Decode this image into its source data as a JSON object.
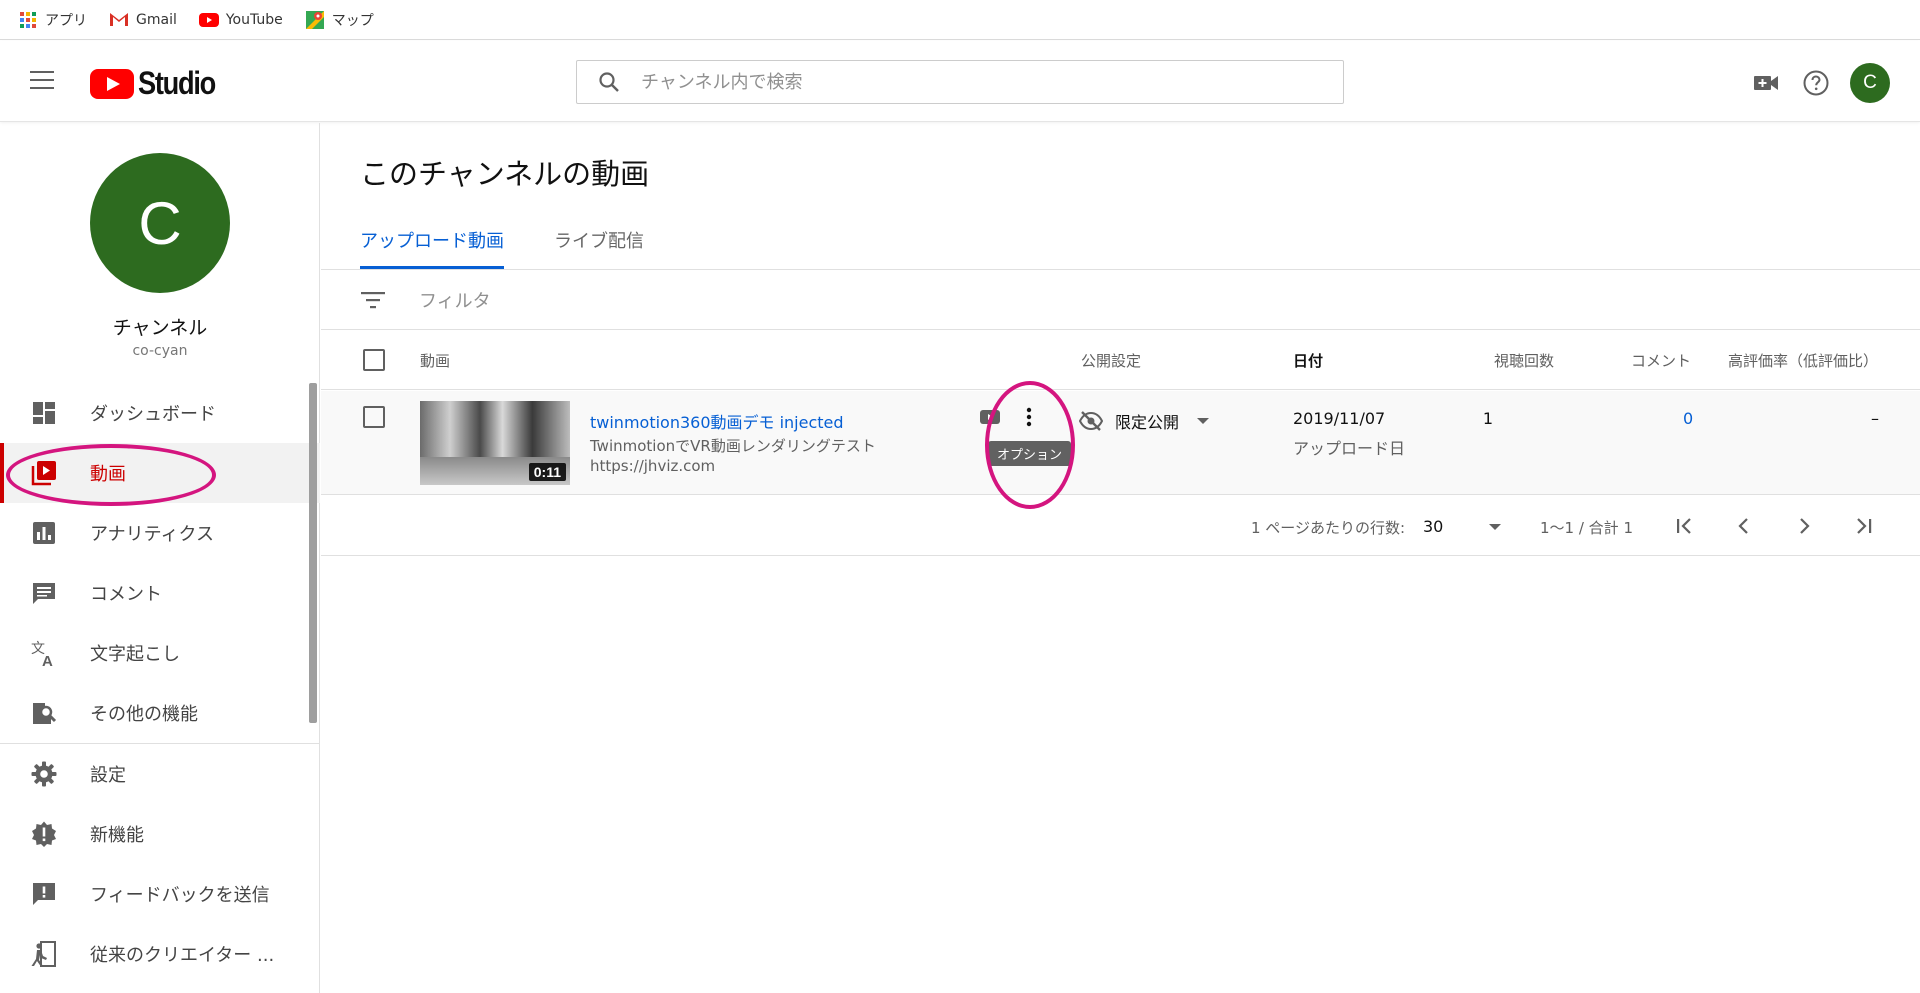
{
  "bookmarks": [
    {
      "label": "アプリ",
      "icon": "apps-grid-icon"
    },
    {
      "label": "Gmail",
      "icon": "gmail-icon"
    },
    {
      "label": "YouTube",
      "icon": "youtube-icon"
    },
    {
      "label": "マップ",
      "icon": "maps-icon"
    }
  ],
  "header": {
    "logo_text": "Studio",
    "search_placeholder": "チャンネル内で検索",
    "avatar_letter": "C"
  },
  "sidebar": {
    "avatar_letter": "C",
    "channel_name": "チャンネル",
    "channel_handle": "co-cyan",
    "items": [
      {
        "label": "ダッシュボード",
        "icon": "dashboard-icon"
      },
      {
        "label": "動画",
        "icon": "video-library-icon",
        "active": true
      },
      {
        "label": "アナリティクス",
        "icon": "analytics-icon"
      },
      {
        "label": "コメント",
        "icon": "comment-icon"
      },
      {
        "label": "文字起こし",
        "icon": "translate-icon"
      },
      {
        "label": "その他の機能",
        "icon": "more-features-icon"
      }
    ],
    "bottom_items": [
      {
        "label": "設定",
        "icon": "settings-gear-icon"
      },
      {
        "label": "新機能",
        "icon": "whats-new-icon"
      },
      {
        "label": "フィードバックを送信",
        "icon": "feedback-icon"
      },
      {
        "label": "従来のクリエイター ...",
        "icon": "classic-studio-icon"
      }
    ]
  },
  "main": {
    "page_title": "このチャンネルの動画",
    "tabs": [
      {
        "label": "アップロード動画",
        "active": true
      },
      {
        "label": "ライブ配信"
      }
    ],
    "filter_label": "フィルタ",
    "columns": {
      "video": "動画",
      "visibility": "公開設定",
      "date": "日付",
      "views": "視聴回数",
      "comments": "コメント",
      "likes": "高評価率（低評価比）"
    },
    "rows": [
      {
        "title": "twinmotion360動画デモ injected",
        "description": "TwinmotionでVR動画レンダリングテスト",
        "url": "https://jhviz.com",
        "duration": "0:11",
        "visibility": "限定公開",
        "date": "2019/11/07",
        "date_note": "アップロード日",
        "views": "1",
        "comments": "0",
        "likes": "–",
        "tooltip": "オプション"
      }
    ],
    "pagination": {
      "rows_per_page_label": "1 ページあたりの行数:",
      "rows_per_page": "30",
      "range": "1～1 / 合計 1"
    }
  },
  "colors": {
    "accent": "#065fd4",
    "active_nav": "#cc0000",
    "annotation": "#d4157f",
    "avatar": "#2d6b1f"
  }
}
